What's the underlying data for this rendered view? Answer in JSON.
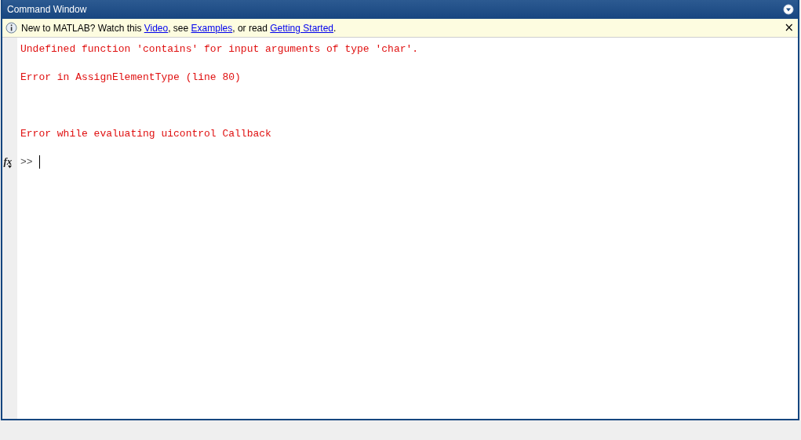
{
  "window": {
    "title": "Command Window"
  },
  "info_bar": {
    "segments": [
      {
        "kind": "text",
        "text": "New to MATLAB? Watch this "
      },
      {
        "kind": "link",
        "text": "Video"
      },
      {
        "kind": "text",
        "text": ", see "
      },
      {
        "kind": "link",
        "text": "Examples"
      },
      {
        "kind": "text",
        "text": ", or read "
      },
      {
        "kind": "link",
        "text": "Getting Started"
      },
      {
        "kind": "text",
        "text": "."
      }
    ],
    "close": "×"
  },
  "output": [
    {
      "kind": "error",
      "text": "Undefined function 'contains' for input arguments of type 'char'."
    },
    {
      "kind": "error-location",
      "text": "Error in AssignElementType (line 80)"
    },
    {
      "kind": "error",
      "text": "Error while evaluating uicontrol Callback"
    }
  ],
  "prompt": {
    "function_button": "fx",
    "symbol": ">>"
  }
}
